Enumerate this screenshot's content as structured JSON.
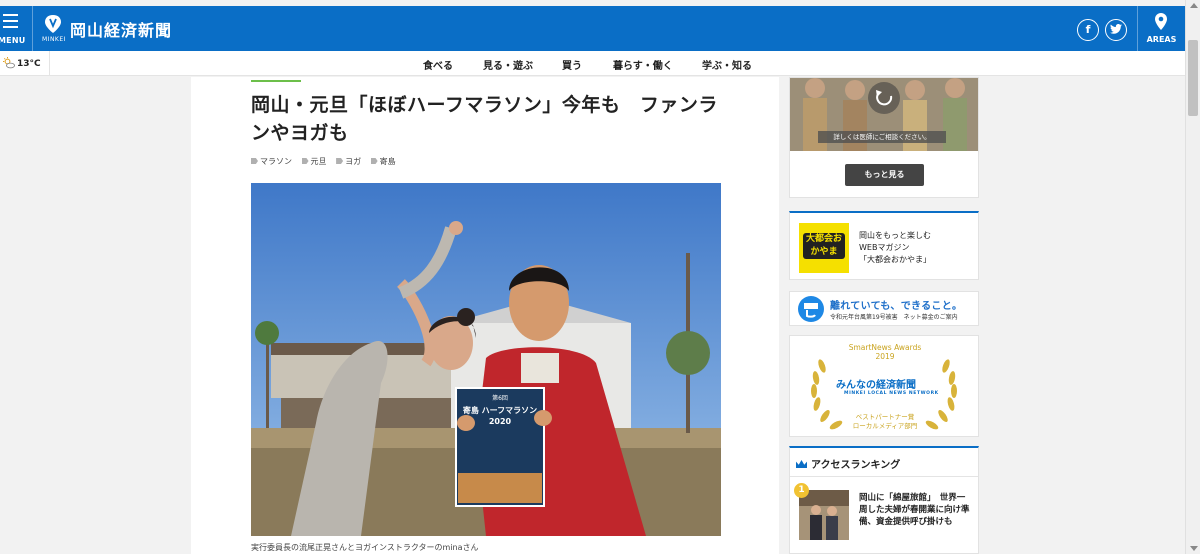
{
  "header": {
    "menu_label": "MENU",
    "logo_sub": "MINKEI",
    "site_title": "岡山経済新聞",
    "facebook_glyph": "f",
    "areas_label": "AREAS",
    "brand_color": "#0a6ec6"
  },
  "weather": {
    "icon": "sun-cloud-icon",
    "temp": "13°C"
  },
  "nav": {
    "items": [
      "食べる",
      "見る・遊ぶ",
      "買う",
      "暮らす・働く",
      "学ぶ・知る"
    ]
  },
  "article": {
    "headline": "岡山・元旦「ほぼハーフマラソン」今年も　ファンランやヨガも",
    "tags": [
      "マラソン",
      "元旦",
      "ヨガ",
      "寄島"
    ],
    "photo": {
      "flyer_line1": "第6回",
      "flyer_line2": "寄島 ハーフマラソン",
      "flyer_line3": "2020"
    },
    "caption": "実行委員長の流尾正晃さんとヨガインストラクターのminaさん"
  },
  "sidebar": {
    "top_card": {
      "banner_text": "詳しくは医師にご相談ください。",
      "more_button": "もっと見る"
    },
    "magazine": {
      "logo_text": "大都会おかやま",
      "line1": "岡山をもっと楽しむ",
      "line2": "WEBマガジン",
      "line3": "「大都会おかやま」"
    },
    "fund": {
      "title": "離れていても、できること。",
      "sub": "令和元年台風第19号被害　ネット募金のご案内"
    },
    "award": {
      "top1": "SmartNews Awards",
      "top2": "2019",
      "logo": "みんなの経済新聞",
      "logo_en": "MINKEI LOCAL NEWS NETWORK",
      "bottom1": "ベストパートナー賞",
      "bottom2": "ローカルメディア部門"
    },
    "ranking": {
      "title": "アクセスランキング",
      "items": [
        {
          "rank": "1",
          "text": "岡山に「綿屋旅館」　世界一周した夫婦が春開業に向け準備、資金提供呼び掛けも"
        }
      ]
    }
  }
}
